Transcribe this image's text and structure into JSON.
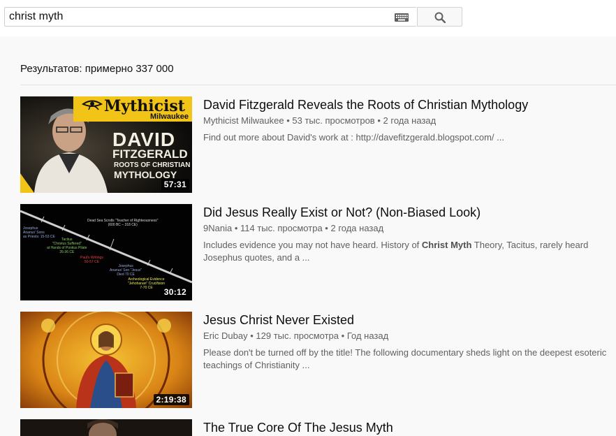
{
  "search": {
    "query": "christ myth"
  },
  "results_count": "Результатов: примерно 337 000",
  "results": [
    {
      "title": "David Fitzgerald Reveals the Roots of Christian Mythology",
      "channel": "Mythicist Milwaukee",
      "views": "53 тыс. просмотров",
      "age": "2 года назад",
      "description": "Find out more about David's work at : http://davefitzgerald.blogspot.com/ ...",
      "duration": "57:31",
      "thumb_text": {
        "brand": "Mythicist",
        "brand_sub": "Milwaukee",
        "line1": "DAVID",
        "line2": "FITZGERALD",
        "line3": "ROOTS OF CHRISTIAN",
        "line4": "MYTHOLOGY"
      }
    },
    {
      "title": "Did Jesus Really Exist or Not? (Non-Biased Look)",
      "channel": "9Nania",
      "views": "114 тыс. просмотра",
      "age": "2 года назад",
      "description_pre": "Includes evidence you may not have heard. History of ",
      "description_bold": "Christ Myth",
      "description_post": " Theory, Tacitus, rarely heard Josephus quotes, and a ...",
      "duration": "30:12",
      "thumb_text": {
        "t1": "Dead Sea Scrolls \"Teacher of Righteousness\"",
        "t1b": "(600 BC – 318 CE)",
        "t2": "Josephus",
        "t2b": "Ananus' Sons",
        "t2c": "as Priests: 15-53 CE",
        "t3": "Tacitus",
        "t3b": "\"Christus Suffered\"",
        "t3c": "at Hands of Pontius Pilate",
        "t3d": "26-36 CE",
        "t4": "Paul's Writings",
        "t4b": "50-57 CE",
        "t5": "Josephus",
        "t5b": "Ananus' Son \"Jesus\"",
        "t5c": "Died 70 CE",
        "t6": "Archeological Evidence",
        "t6b": "\"Jehohanan\" Crucifixion",
        "t6c": "7-70 CE"
      }
    },
    {
      "title": "Jesus Christ Never Existed",
      "channel": "Eric Dubay",
      "views": "129 тыс. просмотра",
      "age": "Год назад",
      "description": "Please don't be turned off by the title! The following documentary sheds light on the deepest esoteric teachings of Christianity ...",
      "duration": "2:19:38"
    },
    {
      "title": "The True Core Of The Jesus Myth"
    }
  ],
  "separator": "•",
  "colors": {
    "brand_yellow": "#f2c417",
    "text_secondary": "#606060",
    "background": "#f9f9f9"
  },
  "icons": {
    "keyboard": "keyboard-icon",
    "search": "search-icon"
  }
}
